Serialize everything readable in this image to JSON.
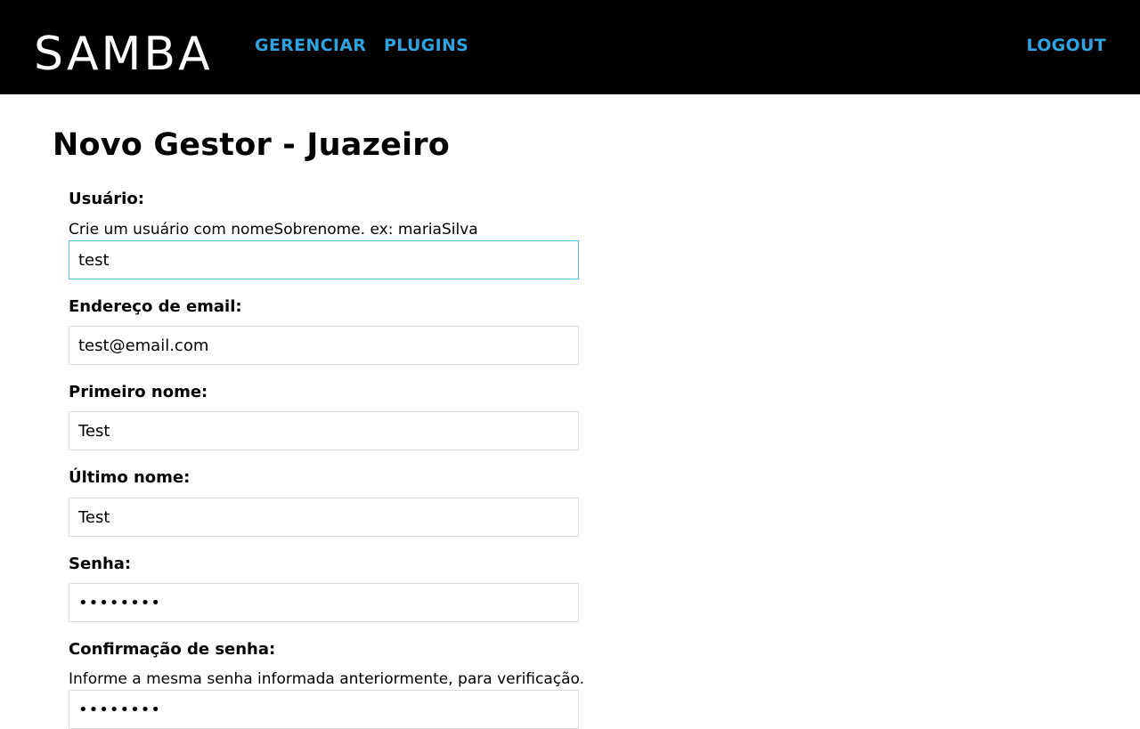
{
  "header": {
    "logo": "SAMBA",
    "nav": {
      "gerenciar": "GERENCIAR",
      "plugins": "PLUGINS",
      "logout": "LOGOUT"
    },
    "link_color": "#2ea3e0",
    "background": "#000000"
  },
  "page": {
    "title": "Novo Gestor - Juazeiro"
  },
  "form": {
    "username": {
      "label": "Usuário:",
      "help": "Crie um usuário com nomeSobrenome. ex: mariaSilva",
      "value": "test"
    },
    "email": {
      "label": "Endereço de email:",
      "value": "test@email.com"
    },
    "first_name": {
      "label": "Primeiro nome:",
      "value": "Test"
    },
    "last_name": {
      "label": "Último nome:",
      "value": "Test"
    },
    "password": {
      "label": "Senha:",
      "value": "••••••••"
    },
    "password_confirm": {
      "label": "Confirmação de senha:",
      "help": "Informe a mesma senha informada anteriormente, para verificação.",
      "value": "••••••••"
    }
  }
}
